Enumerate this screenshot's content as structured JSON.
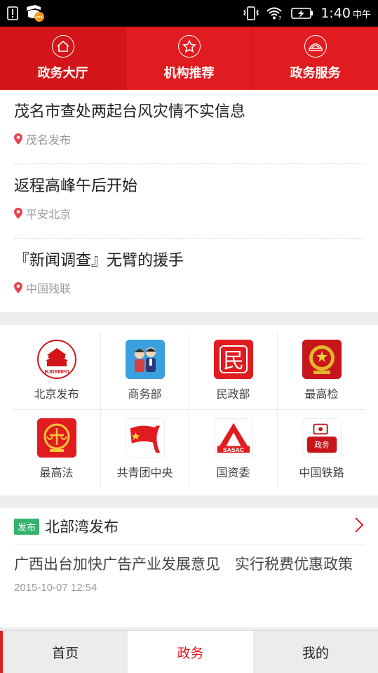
{
  "status_bar": {
    "time": "1:40",
    "period": "中午"
  },
  "tabs": [
    {
      "label": "政务大厅",
      "icon": "home-icon",
      "active": true
    },
    {
      "label": "机构推荐",
      "icon": "star-icon",
      "active": false
    },
    {
      "label": "政务服务",
      "icon": "service-icon",
      "active": false
    }
  ],
  "news": [
    {
      "title": "茂名市查处两起台风灾情不实信息",
      "source": "茂名发布"
    },
    {
      "title": "返程高峰午后开始",
      "source": "平安北京"
    },
    {
      "title": "『新闻调查』无臂的援手",
      "source": "中国残联"
    }
  ],
  "grid": [
    {
      "label": "北京发布",
      "icon": "beijing-release-logo-icon"
    },
    {
      "label": "商务部",
      "icon": "commerce-ministry-logo-icon"
    },
    {
      "label": "民政部",
      "icon": "civil-affairs-logo-icon"
    },
    {
      "label": "最高检",
      "icon": "procuratorate-logo-icon"
    },
    {
      "label": "最高法",
      "icon": "supreme-court-logo-icon"
    },
    {
      "label": "共青团中央",
      "icon": "youth-league-logo-icon"
    },
    {
      "label": "国资委",
      "icon": "sasac-logo-icon"
    },
    {
      "label": "中国铁路",
      "icon": "china-railway-logo-icon"
    }
  ],
  "logo_text": {
    "beijing": "BJDBMPO",
    "minzheng": "民",
    "sasac": "SASAC",
    "railway": "政务"
  },
  "release_card": {
    "badge": "发布",
    "title": "北部湾发布",
    "body": "广西出台加快广告产业发展意见　实行税费优惠政策",
    "date": "2015-10-07 12:54"
  },
  "bottom_nav": [
    {
      "label": "首页",
      "active": false
    },
    {
      "label": "政务",
      "active": true
    },
    {
      "label": "我的",
      "active": false
    }
  ],
  "colors": {
    "brand_red": "#e11c20",
    "badge_green": "#35b36e",
    "text_gray": "#9a9a9a"
  }
}
